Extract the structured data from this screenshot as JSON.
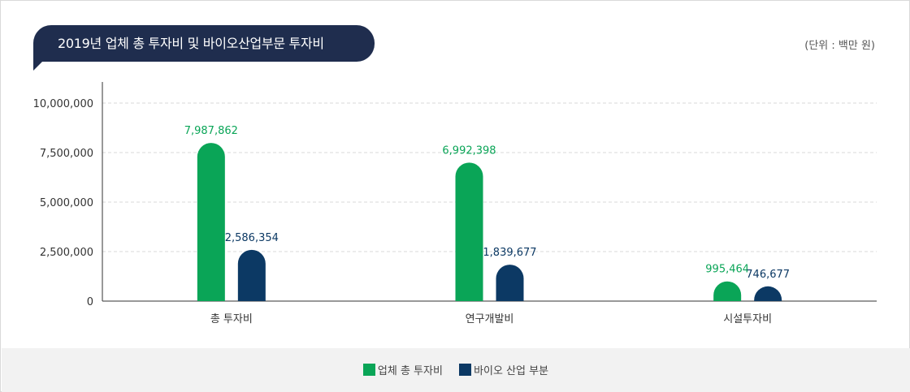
{
  "header": {
    "title": "2019년 업체 총 투자비 및 바이오산업부문 투자비",
    "unit": "(단위 : 백만 원)"
  },
  "colors": {
    "title_bg": "#1f2d4e",
    "series_total": "#0aa557",
    "series_bio": "#0c3964",
    "legend_bg": "#f2f2f2"
  },
  "legend": {
    "items": [
      {
        "label": "업체 총 투자비",
        "color": "#0aa557"
      },
      {
        "label": "바이오 산업 부분",
        "color": "#0c3964"
      }
    ]
  },
  "chart_data": {
    "type": "bar",
    "title": "2019년 업체 총 투자비 및 바이오산업부문 투자비",
    "categories": [
      "총 투자비",
      "연구개발비",
      "시설투자비"
    ],
    "series": [
      {
        "name": "업체 총 투자비",
        "values": [
          7987862,
          6992398,
          995464
        ],
        "value_labels": [
          "7,987,862",
          "6,992,398",
          "995,464"
        ],
        "color": "#0aa557"
      },
      {
        "name": "바이오 산업 부분",
        "values": [
          2586354,
          1839677,
          746677
        ],
        "value_labels": [
          "2,586,354",
          "1,839,677",
          "746,677"
        ],
        "color": "#0c3964"
      }
    ],
    "ylim": [
      0,
      10000000
    ],
    "yticks": [
      0,
      2500000,
      5000000,
      7500000,
      10000000
    ],
    "ytick_labels": [
      "0",
      "2,500,000",
      "5,000,000",
      "7,500,000",
      "10,000,000"
    ],
    "xlabel": "",
    "ylabel": "",
    "grid": true,
    "legend_position": "bottom"
  }
}
